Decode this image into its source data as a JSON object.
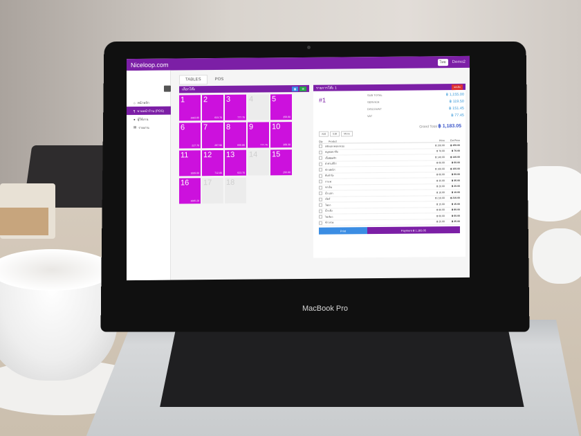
{
  "app": {
    "logo": "Niceloop.com",
    "lang": "ไทย",
    "user": "Demo2"
  },
  "tabs": [
    {
      "label": "TABLES"
    },
    {
      "label": "POS"
    }
  ],
  "sidebar": {
    "items": [
      {
        "label": "หน้าหลัก"
      },
      {
        "label": "ขายหน้าร้าน (POS)"
      },
      {
        "label": "ผู้ใช้งาน"
      },
      {
        "label": "รายงาน"
      }
    ]
  },
  "tables_panel": {
    "title": "เลือกโต๊ะ",
    "tables": [
      {
        "num": "1",
        "amount": "1583.05",
        "status": "busy"
      },
      {
        "num": "2",
        "amount": "623.70",
        "status": "busy"
      },
      {
        "num": "3",
        "amount": "777.75",
        "status": "busy"
      },
      {
        "num": "4",
        "amount": "",
        "status": "free"
      },
      {
        "num": "5",
        "amount": "356.60",
        "status": "busy"
      },
      {
        "num": "6",
        "amount": "227.70",
        "status": "busy"
      },
      {
        "num": "7",
        "amount": "267.90",
        "status": "busy"
      },
      {
        "num": "8",
        "amount": "835.80",
        "status": "busy"
      },
      {
        "num": "9",
        "amount": "777.75",
        "status": "busy"
      },
      {
        "num": "10",
        "amount": "368.30",
        "status": "busy"
      },
      {
        "num": "11",
        "amount": "1009.00",
        "status": "busy"
      },
      {
        "num": "12",
        "amount": "712.80",
        "status": "busy"
      },
      {
        "num": "13",
        "amount": "623.70",
        "status": "busy"
      },
      {
        "num": "14",
        "amount": "",
        "status": "free"
      },
      {
        "num": "15",
        "amount": "293.00",
        "status": "busy"
      },
      {
        "num": "16",
        "amount": "1065.20",
        "status": "busy"
      },
      {
        "num": "17",
        "amount": "",
        "status": "free"
      },
      {
        "num": "18",
        "amount": "",
        "status": "free"
      }
    ]
  },
  "order": {
    "title": "รายการโต๊ะ 1",
    "cancel_label": "ยกเลิก",
    "table_no": "#1",
    "subtotal_label": "SUB TOTAL",
    "subtotal": "฿ 1,155.00",
    "service_label": "SERVICE",
    "service": "฿ 119.50",
    "discount_label": "DISCOUNT",
    "discount": "฿ 151.45",
    "vat_label": "VAT",
    "vat": "฿ 77.45",
    "grand_label": "Grand Total",
    "grand": "฿ 1,183.05",
    "actions": [
      "Add",
      "Edit",
      "Move"
    ],
    "cols": {
      "qty": "Qty",
      "product": "Product",
      "price": "Price",
      "total": "Ext.Price"
    },
    "items": [
      {
        "qty": "1",
        "name": "สลัดปลาทอดกรอบ",
        "price": "฿ 150.00",
        "total": "฿ 150.00"
      },
      {
        "qty": "1",
        "name": "หมูทอดเกลือ",
        "price": "฿ 70.00",
        "total": "฿ 70.00"
      },
      {
        "qty": "1",
        "name": "เนื้อผัดพริก",
        "price": "฿ 140.00",
        "total": "฿ 140.00"
      },
      {
        "qty": "1",
        "name": "ยำหัวปลีไก่",
        "price": "฿ 60.00",
        "total": "฿ 60.00"
      },
      {
        "qty": "1",
        "name": "ข้าวผัดไก่",
        "price": "฿ 100.00",
        "total": "฿ 100.00"
      },
      {
        "qty": "1",
        "name": "ต้มยำกุ้ง",
        "price": "฿ 60.00",
        "total": "฿ 60.00"
      },
      {
        "qty": "1",
        "name": "กาแฟ",
        "price": "฿ 35.00",
        "total": "฿ 35.00"
      },
      {
        "qty": "1",
        "name": "ชาเย็น",
        "price": "฿ 20.00",
        "total": "฿ 20.00"
      },
      {
        "qty": "1",
        "name": "น้ำเปล่า",
        "price": "฿ 10.00",
        "total": "฿ 10.00"
      },
      {
        "qty": "1",
        "name": "เบียร์",
        "price": "฿ 210.00",
        "total": "฿ 210.00"
      },
      {
        "qty": "1",
        "name": "โซดา",
        "price": "฿ 15.00",
        "total": "฿ 15.00"
      },
      {
        "qty": "1",
        "name": "น้ำแข็ง",
        "price": "฿ 80.00",
        "total": "฿ 80.00"
      },
      {
        "qty": "1",
        "name": "ไข่เจียว",
        "price": "฿ 60.00",
        "total": "฿ 60.00"
      },
      {
        "qty": "1",
        "name": "ข้าวสวย",
        "price": "฿ 25.00",
        "total": "฿ 25.00"
      }
    ],
    "print_label": "Print",
    "payment_label": "Payment",
    "payment_value": "฿ 1,183.05"
  },
  "laptop": {
    "brand": "MacBook Pro"
  }
}
